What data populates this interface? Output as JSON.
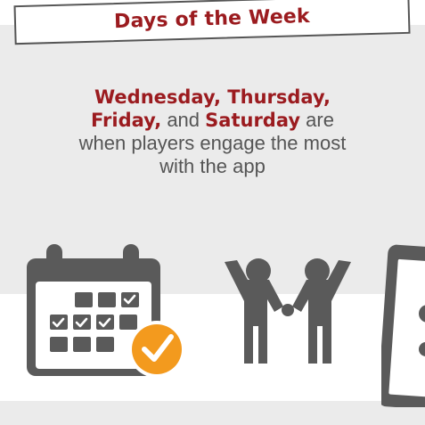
{
  "header": {
    "title": "Days of the Week"
  },
  "statement": {
    "line1": "Wednesday, Thursday,",
    "highlight_friday": "Friday,",
    "and_word": "and",
    "highlight_saturday": "Saturday",
    "are_word": "are",
    "line3": "when players engage the most",
    "line4": "with the app"
  },
  "colors": {
    "accent": "#9b1b1f",
    "icon_gray": "#5a5a5a",
    "check_badge": "#f39a1e",
    "panel_bg": "#ebebeb"
  },
  "icons": [
    "calendar-check-icon",
    "two-players-cheering-icon",
    "tablet-device-icon"
  ]
}
